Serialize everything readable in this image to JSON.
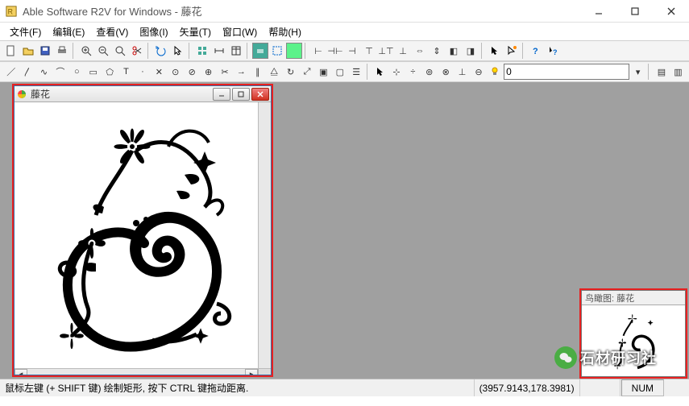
{
  "app": {
    "title": "Able Software R2V for Windows - 藤花"
  },
  "menus": {
    "file": "文件(F)",
    "edit": "编辑(E)",
    "view": "查看(V)",
    "image": "图像(I)",
    "vector": "矢量(T)",
    "window": "窗口(W)",
    "help": "帮助(H)"
  },
  "toolbar2": {
    "combo_value": "0"
  },
  "doc": {
    "title": "藤花"
  },
  "thumb": {
    "title": "鸟瞰图: 藤花"
  },
  "status": {
    "hint": "鼠标左键 (+ SHIFT 键) 绘制矩形, 按下 CTRL 键拖动距离.",
    "coords": "(3957.9143,178.3981)",
    "num": "NUM"
  },
  "watermark": {
    "text": "石材研习社"
  }
}
